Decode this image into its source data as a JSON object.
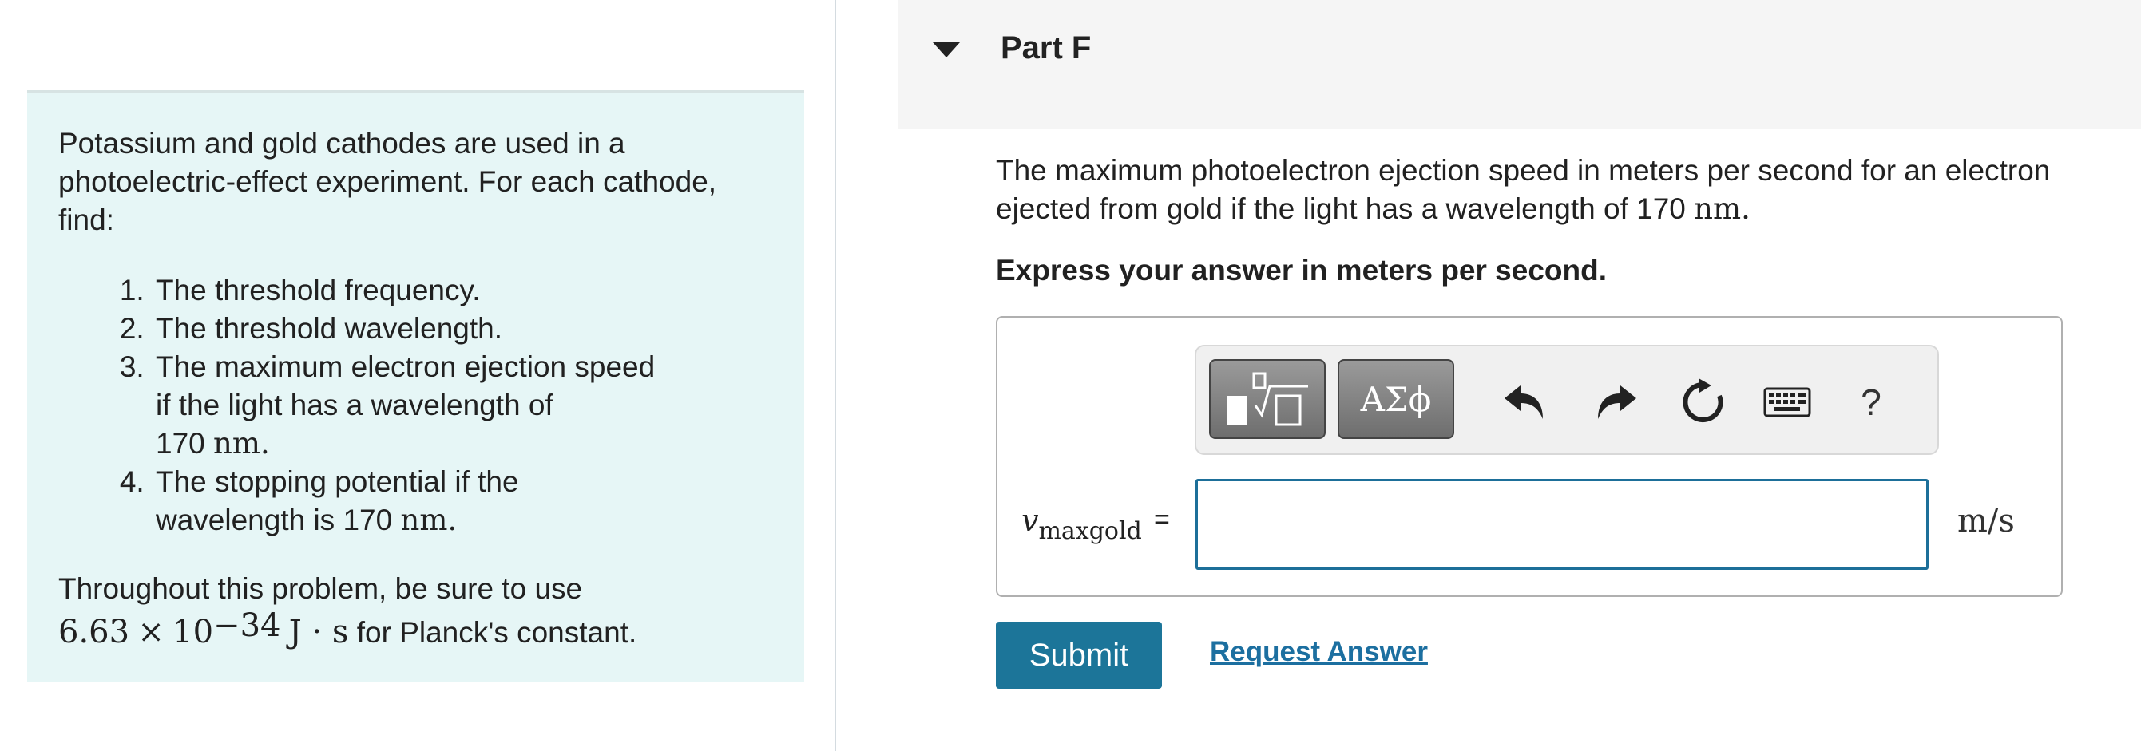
{
  "problem": {
    "intro": "Potassium and gold cathodes are used in a photoelectric-effect experiment. For each cathode, find:",
    "tasks": [
      {
        "label": "The threshold frequency."
      },
      {
        "label": "The threshold wavelength."
      },
      {
        "line1": "The maximum electron ejection speed",
        "line2": "if the light has a wavelength of",
        "value": "170",
        "unit": "nm",
        "end": "."
      },
      {
        "line1": "The stopping potential if the",
        "line2": "wavelength is 170",
        "unit": "nm",
        "end": "."
      }
    ],
    "throughout": "Throughout this problem, be sure to use",
    "planck": {
      "mantissa": "6.63",
      "times": "×",
      "base": "10",
      "exponent": "−34",
      "unit": "J · s",
      "suffix": "for Planck's constant."
    }
  },
  "part": {
    "title": "Part F",
    "question_text": "The maximum photoelectron ejection speed in meters per second for an electron ejected from gold if the light has a wavelength of 170",
    "question_unit": "nm",
    "question_end": ".",
    "instruction": "Express your answer in meters per second."
  },
  "answer": {
    "variable_main": "v",
    "variable_sub": "maxgold",
    "equals": "=",
    "value": "",
    "unit": "m/s"
  },
  "toolbar": {
    "symbols_label": "ΑΣϕ",
    "help_label": "?"
  },
  "actions": {
    "submit_label": "Submit",
    "request_answer_label": "Request Answer"
  },
  "colors": {
    "problem_bg": "#e6f6f6",
    "submit_bg": "#1c7599",
    "link": "#1c6fa0",
    "input_border": "#1d6f99"
  }
}
